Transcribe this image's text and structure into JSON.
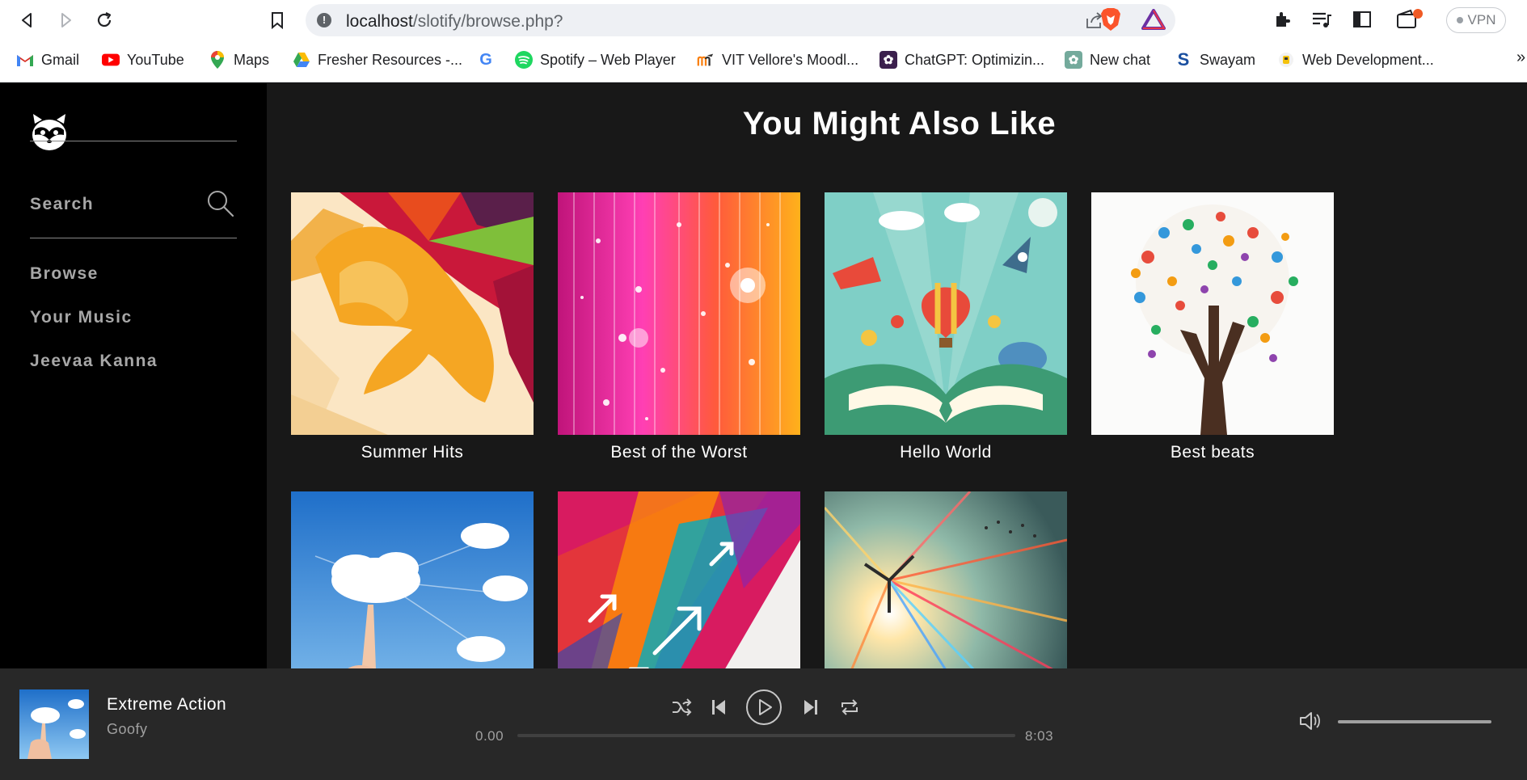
{
  "browser": {
    "url_host": "localhost",
    "url_path": "/slotify/browse.php?",
    "info_glyph": "!",
    "vpn_label": "VPN",
    "more_glyph": "»",
    "bookmarks": [
      {
        "label": "Gmail",
        "icon": "gmail-icon",
        "glyph": "M",
        "color": "#d93025"
      },
      {
        "label": "YouTube",
        "icon": "youtube-icon",
        "glyph": "▶",
        "color": "#ff0000"
      },
      {
        "label": "Maps",
        "icon": "maps-icon",
        "glyph": "",
        "color": "#34a853"
      },
      {
        "label": "Fresher Resources -...",
        "icon": "drive-icon",
        "glyph": "▲",
        "color": "#1a73e8"
      },
      {
        "label": "",
        "icon": "google-icon",
        "glyph": "G",
        "color": "#4285f4"
      },
      {
        "label": "Spotify – Web Player",
        "icon": "spotify-icon",
        "glyph": "≋",
        "color": "#1ed760"
      },
      {
        "label": "VIT Vellore's Moodl...",
        "icon": "moodle-icon",
        "glyph": "m",
        "color": "#f98012"
      },
      {
        "label": "ChatGPT: Optimizin...",
        "icon": "chatgpt-dark-icon",
        "glyph": "✿",
        "color": "#3b1f4d"
      },
      {
        "label": "New chat",
        "icon": "chatgpt-icon",
        "glyph": "✿",
        "color": "#74aa9c"
      },
      {
        "label": "Swayam",
        "icon": "swayam-icon",
        "glyph": "S",
        "color": "#1a4fa0"
      },
      {
        "label": "Web Development...",
        "icon": "web-dev-icon",
        "glyph": "●",
        "color": "#f4c20d"
      }
    ]
  },
  "sidebar": {
    "search_label": "Search",
    "items": [
      "Browse",
      "Your Music",
      "Jeevaa Kanna"
    ]
  },
  "main": {
    "title": "You Might Also Like",
    "albums": [
      {
        "title": "Summer Hits"
      },
      {
        "title": "Best of the Worst"
      },
      {
        "title": "Hello World"
      },
      {
        "title": "Best beats"
      },
      {
        "title": ""
      },
      {
        "title": ""
      },
      {
        "title": ""
      }
    ]
  },
  "player": {
    "track_title": "Extreme Action",
    "artist": "Goofy",
    "current_time": "0.00",
    "total_time": "8:03",
    "progress": 0,
    "volume": 1.0
  },
  "colors": {
    "sidebar_bg": "#000000",
    "main_bg": "#181818",
    "player_bg": "#282828",
    "text_muted": "#a7a7a7"
  }
}
